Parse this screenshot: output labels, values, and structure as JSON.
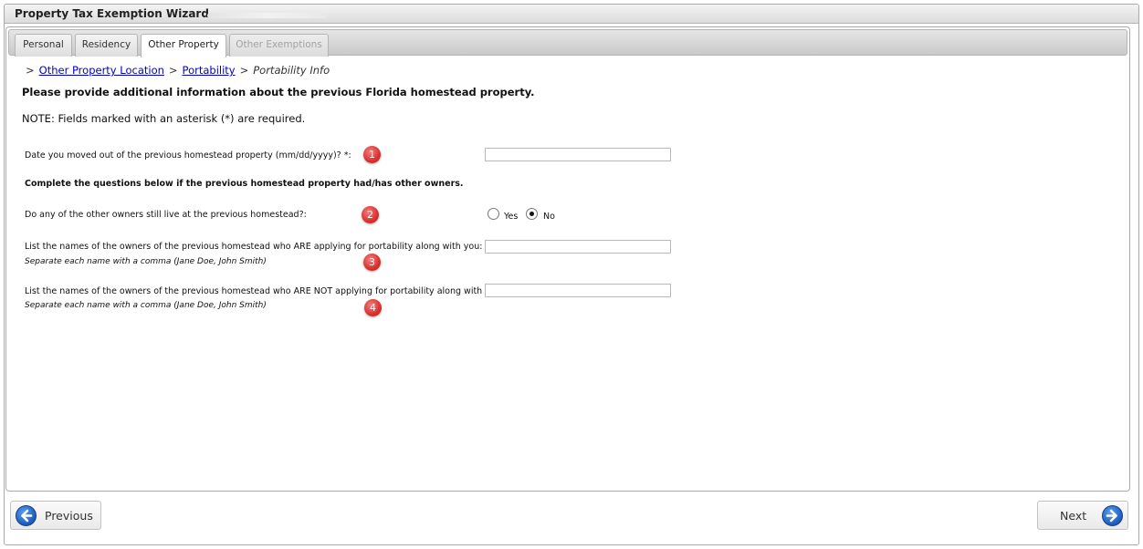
{
  "window": {
    "title": "Property Tax Exemption Wizard -"
  },
  "tabs": [
    {
      "label": "Personal"
    },
    {
      "label": "Residency"
    },
    {
      "label": "Other Property"
    },
    {
      "label": "Other Exemptions"
    }
  ],
  "breadcrumb": {
    "marker": ">",
    "items": [
      "Other Property Location",
      "Portability",
      "Portability Info"
    ]
  },
  "heading": "Please provide additional information about the previous Florida homestead property.",
  "note": "NOTE: Fields marked with an asterisk (*) are required.",
  "form": {
    "moved_out_label": "Date you moved out of the previous homestead property (mm/dd/yyyy)? *:",
    "moved_out_value": "",
    "other_owners_heading": "Complete the questions below if the previous homestead property had/has other owners.",
    "still_live_label": "Do any of the other owners still live at the previous homestead?:",
    "still_live_options": [
      {
        "label": "Yes",
        "checked": false
      },
      {
        "label": "No",
        "checked": true
      }
    ],
    "applying_label": "List the names of the owners of the previous homestead who ARE applying for portability along with you:",
    "applying_hint": "Separate each name with a comma (Jane Doe, John Smith)",
    "applying_value": "",
    "not_applying_label": "List the names of the owners of the previous homestead who ARE NOT applying for portability along with you:",
    "not_applying_hint": "Separate each name with a comma (Jane Doe, John Smith)",
    "not_applying_value": ""
  },
  "badges": [
    "1",
    "2",
    "3",
    "4"
  ],
  "footer": {
    "previous_label": "Previous",
    "next_label": "Next"
  }
}
